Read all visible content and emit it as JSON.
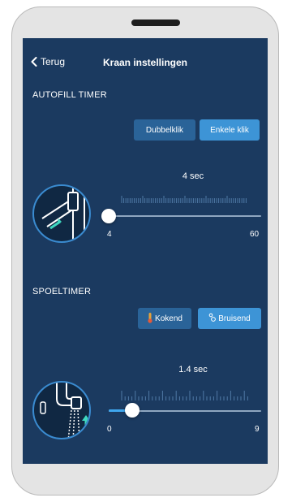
{
  "header": {
    "back_label": "Terug",
    "title": "Kraan instellingen"
  },
  "autofill": {
    "section_title": "AUTOFILL TIMER",
    "modes": [
      {
        "label": "Dubbelklik",
        "active": false
      },
      {
        "label": "Enkele klik",
        "active": true
      }
    ],
    "value_label": "4 sec",
    "value": 4,
    "min": 4,
    "max": 60,
    "min_label": "4",
    "max_label": "60",
    "icon": "tap-lever-press-icon"
  },
  "spoeltimer": {
    "section_title": "SPOELTIMER",
    "modes": [
      {
        "label": "Kokend",
        "icon": "thermometer-icon",
        "active": false
      },
      {
        "label": "Bruisend",
        "icon": "bubbles-icon",
        "active": true
      }
    ],
    "value_label": "1.4 sec",
    "value": 1.4,
    "min": 0,
    "max": 9,
    "min_label": "0",
    "max_label": "9",
    "icon": "tap-flush-icon"
  },
  "colors": {
    "screen_bg": "#1b3a60",
    "button_inactive": "#2a6398",
    "button_active": "#3d94d6",
    "accent": "#3fa7ee"
  }
}
